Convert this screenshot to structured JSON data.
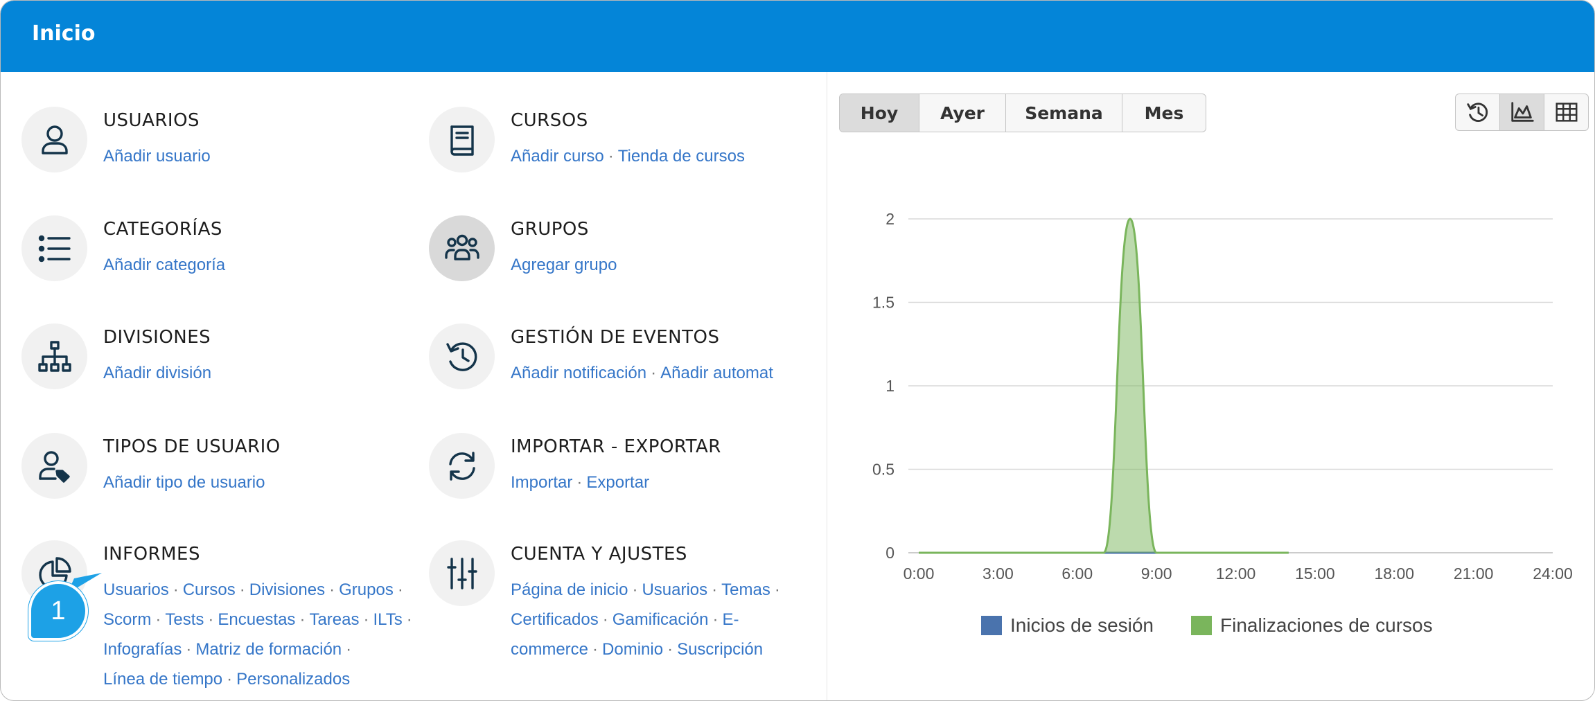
{
  "header": {
    "title": "Inicio"
  },
  "modules": [
    {
      "id": "usuarios",
      "title": "USUARIOS",
      "icon": "user-icon",
      "links": [
        "Añadir usuario"
      ]
    },
    {
      "id": "cursos",
      "title": "CURSOS",
      "icon": "book-icon",
      "links": [
        "Añadir curso",
        "Tienda de cursos"
      ]
    },
    {
      "id": "categorias",
      "title": "CATEGORÍAS",
      "icon": "list-icon",
      "links": [
        "Añadir categoría"
      ]
    },
    {
      "id": "grupos",
      "title": "GRUPOS",
      "icon": "group-icon",
      "links": [
        "Agregar grupo"
      ]
    },
    {
      "id": "divisiones",
      "title": "DIVISIONES",
      "icon": "org-chart-icon",
      "links": [
        "Añadir división"
      ]
    },
    {
      "id": "eventos",
      "title": "GESTIÓN DE EVENTOS",
      "icon": "history-icon",
      "links": [
        "Añadir notificación",
        "Añadir automat"
      ]
    },
    {
      "id": "tipos",
      "title": "TIPOS DE USUARIO",
      "icon": "user-tag-icon",
      "links": [
        "Añadir tipo de usuario"
      ]
    },
    {
      "id": "importar",
      "title": "IMPORTAR - EXPORTAR",
      "icon": "sync-icon",
      "links": [
        "Importar",
        "Exportar"
      ]
    },
    {
      "id": "informes",
      "title": "INFORMES",
      "icon": "pie-chart-icon",
      "link_lines": [
        [
          "Usuarios",
          "Cursos",
          "Divisiones",
          "Grupos"
        ],
        [
          "Scorm",
          "Tests",
          "Encuestas",
          "Tareas",
          "ILTs"
        ],
        [
          "Infografías",
          "Matriz de formación"
        ],
        [
          "Línea de tiempo",
          "Personalizados"
        ]
      ]
    },
    {
      "id": "cuenta",
      "title": "CUENTA Y AJUSTES",
      "icon": "sliders-icon",
      "link_lines": [
        [
          "Página de inicio",
          "Usuarios",
          "Temas"
        ],
        [
          "Certificados",
          "Gamificación",
          "E-"
        ],
        [
          "commerce",
          "Dominio",
          "Suscripción"
        ]
      ]
    }
  ],
  "badge": {
    "number": "1"
  },
  "period_tabs": {
    "items": [
      "Hoy",
      "Ayer",
      "Semana",
      "Mes"
    ],
    "selected": "Hoy"
  },
  "view_toggle": {
    "items": [
      "history-icon",
      "area-chart-icon",
      "table-icon"
    ],
    "selected": "area-chart-icon"
  },
  "colors": {
    "header": "#0485d8",
    "link": "#3576c8",
    "series_login": "#4a73ad",
    "series_completion": "#7ab55c"
  },
  "chart_data": {
    "type": "area",
    "x": [
      "0:00",
      "1:00",
      "2:00",
      "3:00",
      "4:00",
      "5:00",
      "6:00",
      "7:00",
      "8:00",
      "9:00",
      "10:00",
      "11:00",
      "12:00",
      "13:00",
      "14:00"
    ],
    "x_ticks": [
      "0:00",
      "3:00",
      "6:00",
      "9:00",
      "12:00",
      "15:00",
      "18:00",
      "21:00",
      "24:00"
    ],
    "y_ticks": [
      "0",
      "0.5",
      "1",
      "1.5",
      "2"
    ],
    "xlim": [
      0,
      24
    ],
    "ylim": [
      0,
      2
    ],
    "grid": true,
    "legend_position": "bottom",
    "series": [
      {
        "name": "Inicios de sesión",
        "values": [
          0,
          0,
          0,
          0,
          0,
          0,
          0,
          0,
          0,
          0,
          0,
          0,
          0,
          0,
          0
        ]
      },
      {
        "name": "Finalizaciones de cursos",
        "values": [
          0,
          0,
          0,
          0,
          0,
          0,
          0,
          0,
          2,
          0,
          0,
          0,
          0,
          0,
          0
        ]
      }
    ]
  }
}
